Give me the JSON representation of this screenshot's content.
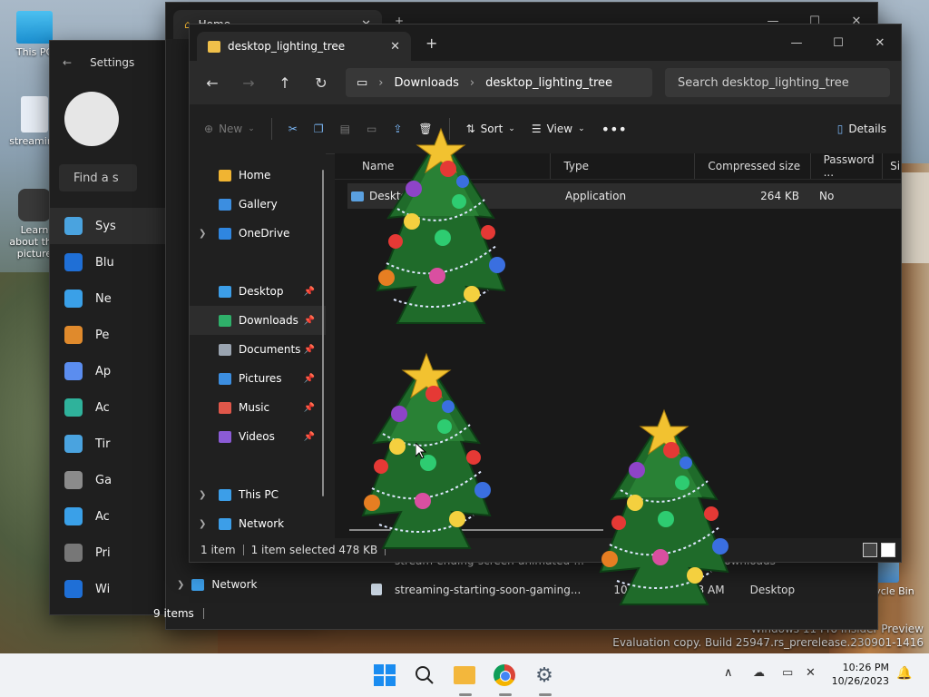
{
  "desktop": {
    "icons": [
      {
        "label": "This PC"
      },
      {
        "label": "streaming"
      },
      {
        "label": "Learn about this picture"
      }
    ],
    "recycle_bin": "Recycle Bin",
    "watermark": {
      "line1": "Windows 11 Pro Insider Preview",
      "line2": "Evaluation copy. Build 25947.rs_prerelease.230901-1416"
    }
  },
  "settings_window": {
    "title": "Settings",
    "search_placeholder": "Find a s",
    "items": [
      {
        "label": "Sys",
        "icon": "display-icon",
        "color": "#4aa3df"
      },
      {
        "label": "Blu",
        "icon": "bluetooth-icon",
        "color": "#1f6fd6"
      },
      {
        "label": "Ne",
        "icon": "wifi-icon",
        "color": "#3aa0e8"
      },
      {
        "label": "Pe",
        "icon": "brush-icon",
        "color": "#e08a2c"
      },
      {
        "label": "Ap",
        "icon": "apps-icon",
        "color": "#5b8def"
      },
      {
        "label": "Ac",
        "icon": "account-icon",
        "color": "#2fb29b"
      },
      {
        "label": "Tir",
        "icon": "clock-icon",
        "color": "#4aa3df"
      },
      {
        "label": "Ga",
        "icon": "gamepad-icon",
        "color": "#8b8b8b"
      },
      {
        "label": "Ac",
        "icon": "accessibility-icon",
        "color": "#3aa0e8"
      },
      {
        "label": "Pri",
        "icon": "shield-icon",
        "color": "#777"
      },
      {
        "label": "Wi",
        "icon": "update-icon",
        "color": "#1f6fd6"
      }
    ]
  },
  "explorer_back": {
    "tab_title": "Home",
    "nav": [
      {
        "label": "Network"
      }
    ],
    "items_count": "9 items",
    "rows": [
      {
        "name": "stream-ending-screen-animated-...",
        "location": "Downloads"
      },
      {
        "name": "streaming-starting-soon-gaming...",
        "date": "10/26/2023 9:53 AM",
        "location": "Desktop"
      }
    ]
  },
  "explorer_front": {
    "tab_title": "desktop_lighting_tree",
    "new_tab": "+",
    "breadcrumb": [
      "Downloads",
      "desktop_lighting_tree"
    ],
    "search_placeholder": "Search desktop_lighting_tree",
    "commands": {
      "new": "New",
      "sort": "Sort",
      "view": "View",
      "details": "Details"
    },
    "nav": [
      {
        "label": "Home",
        "icon": "home-icon",
        "color": "#f0b432",
        "chevron": false,
        "pin": false
      },
      {
        "label": "Gallery",
        "icon": "gallery-icon",
        "color": "#3c8ee0",
        "chevron": false,
        "pin": false
      },
      {
        "label": "OneDrive",
        "icon": "cloud-icon",
        "color": "#2f86e0",
        "chevron": true,
        "pin": false
      },
      {
        "label": "Desktop",
        "icon": "desktop-icon",
        "color": "#3c9ee8",
        "chevron": false,
        "pin": true
      },
      {
        "label": "Downloads",
        "icon": "download-icon",
        "color": "#2fb06a",
        "chevron": false,
        "pin": true
      },
      {
        "label": "Documents",
        "icon": "document-icon",
        "color": "#9aa4b0",
        "chevron": false,
        "pin": true
      },
      {
        "label": "Pictures",
        "icon": "pictures-icon",
        "color": "#3c8ee0",
        "chevron": false,
        "pin": true
      },
      {
        "label": "Music",
        "icon": "music-icon",
        "color": "#e0574a",
        "chevron": false,
        "pin": true
      },
      {
        "label": "Videos",
        "icon": "videos-icon",
        "color": "#8b5bd6",
        "chevron": false,
        "pin": true
      },
      {
        "label": "This PC",
        "icon": "pc-icon",
        "color": "#3c9ee8",
        "chevron": true,
        "pin": false
      },
      {
        "label": "Network",
        "icon": "network-icon",
        "color": "#3c9ee8",
        "chevron": true,
        "pin": false
      }
    ],
    "columns": [
      "Name",
      "Type",
      "Compressed size",
      "Password ...",
      "Si"
    ],
    "files": [
      {
        "name": "Desktop",
        "type": "Application",
        "size": "264 KB",
        "password": "No"
      }
    ],
    "status": {
      "count": "1 item",
      "selected": "1 item selected  478 KB"
    }
  },
  "taskbar": {
    "time": "10:26 PM",
    "date": "10/26/2023"
  }
}
